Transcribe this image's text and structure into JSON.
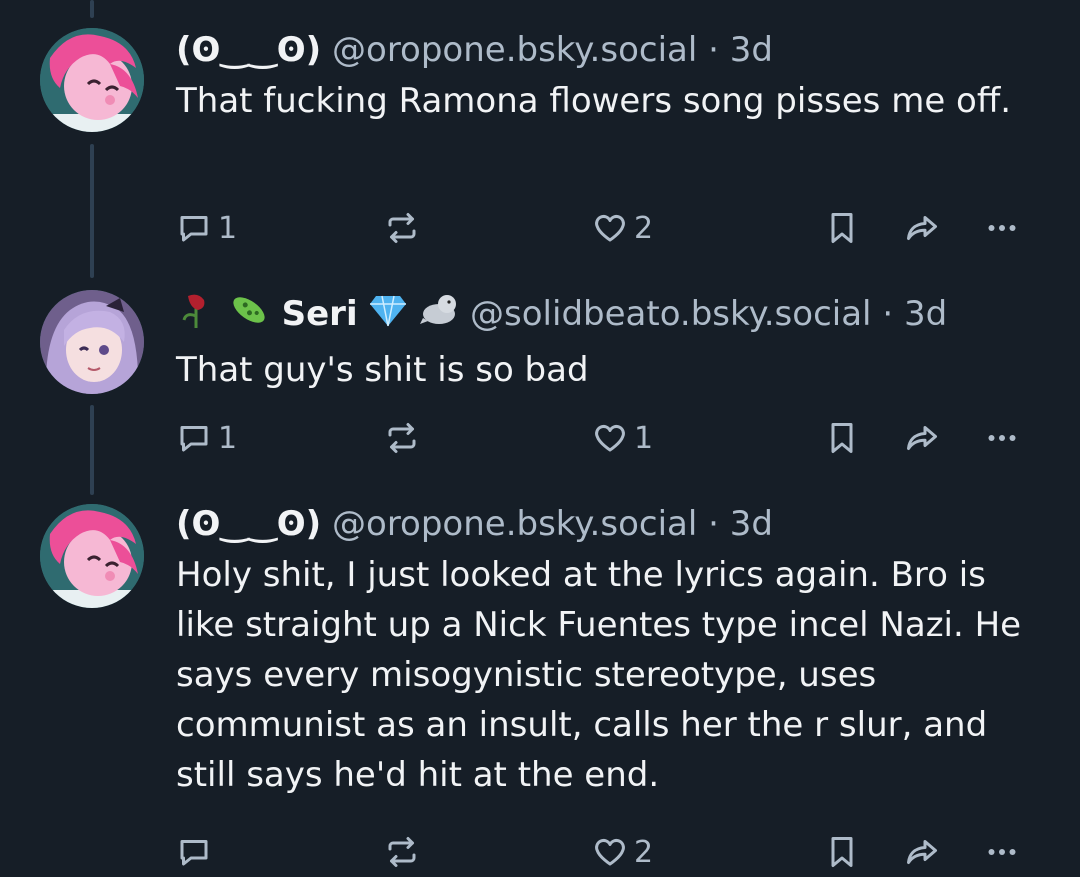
{
  "posts": [
    {
      "display_name": "(ʘ‿‿ʘ)",
      "handle": "@oropone.bsky.social",
      "separator": "·",
      "time": "3d",
      "text": "That fucking Ramona flowers song pisses me off.",
      "reply_count": "1",
      "repost_count": "",
      "like_count": "2",
      "avatar_icon": "pink-pony-avatar"
    },
    {
      "display_name": "Seri",
      "handle": "@solidbeato.bsky.social",
      "separator": "·",
      "time": "3d",
      "text": "That guy's shit is so bad",
      "reply_count": "1",
      "repost_count": "",
      "like_count": "1",
      "avatar_icon": "anime-girl-avatar",
      "name_emojis_before": [
        "wilted-rose-icon",
        "microbe-icon"
      ],
      "name_emojis_after": [
        "gem-icon",
        "seal-icon"
      ]
    },
    {
      "display_name": "(ʘ‿‿ʘ)",
      "handle": "@oropone.bsky.social",
      "separator": "·",
      "time": "3d",
      "text": "Holy shit, I just looked at the lyrics again. Bro is like straight up a Nick Fuentes type incel Nazi. He says every misogynistic stereotype, uses communist as an insult, calls her the r slur, and still says he'd hit at the end.",
      "reply_count": "",
      "repost_count": "",
      "like_count": "2",
      "avatar_icon": "pink-pony-avatar"
    }
  ],
  "colors": {
    "background": "#161e27",
    "text": "#f1f3f5",
    "muted": "#aebbc9",
    "thread_line": "#2e4052"
  }
}
